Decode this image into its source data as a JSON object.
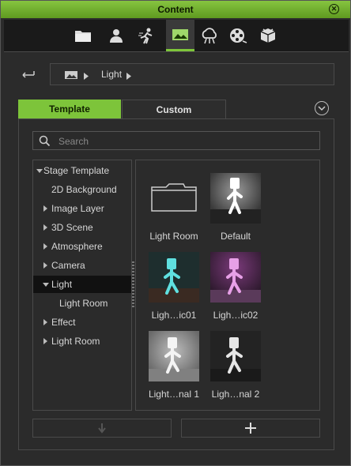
{
  "window": {
    "title": "Content"
  },
  "toolbar": {
    "tabs": [
      {
        "icon": "folder-icon"
      },
      {
        "icon": "person-icon"
      },
      {
        "icon": "motion-icon"
      },
      {
        "icon": "stage-icon"
      },
      {
        "icon": "sky-icon"
      },
      {
        "icon": "film-reel-icon"
      },
      {
        "icon": "package-icon"
      }
    ],
    "active_index": 3
  },
  "breadcrumb": {
    "path": [
      "Light"
    ]
  },
  "tabs": {
    "template": "Template",
    "custom": "Custom",
    "active": "Template"
  },
  "search": {
    "placeholder": "Search",
    "value": ""
  },
  "tree": {
    "items": [
      {
        "label": "Stage Template",
        "expanded": true
      },
      {
        "label": "2D Background"
      },
      {
        "label": "Image Layer",
        "expanded": false
      },
      {
        "label": "3D Scene",
        "expanded": false
      },
      {
        "label": "Atmosphere",
        "expanded": false
      },
      {
        "label": "Camera",
        "expanded": false
      },
      {
        "label": "Light",
        "expanded": true,
        "selected": true
      },
      {
        "label": "Light Room"
      },
      {
        "label": "Effect",
        "expanded": false
      },
      {
        "label": "Light Room",
        "expanded": false
      }
    ]
  },
  "grid": {
    "items": [
      {
        "label": "Light Room",
        "kind": "folder"
      },
      {
        "label": "Default",
        "kind": "figure",
        "tint": "#ffffff"
      },
      {
        "label": "Ligh…ic01",
        "kind": "figure",
        "tint": "#5fe0e0"
      },
      {
        "label": "Ligh…ic02",
        "kind": "figure",
        "tint": "#e07ce0"
      },
      {
        "label": "Light…nal 1",
        "kind": "figure",
        "tint": "#ffffff"
      },
      {
        "label": "Ligh…nal 2",
        "kind": "figure",
        "tint": "#ffffff"
      }
    ]
  },
  "actions": {
    "apply_icon": "down-arrow-icon",
    "add_icon": "plus-icon"
  },
  "colors": {
    "accent": "#7dc43a"
  }
}
